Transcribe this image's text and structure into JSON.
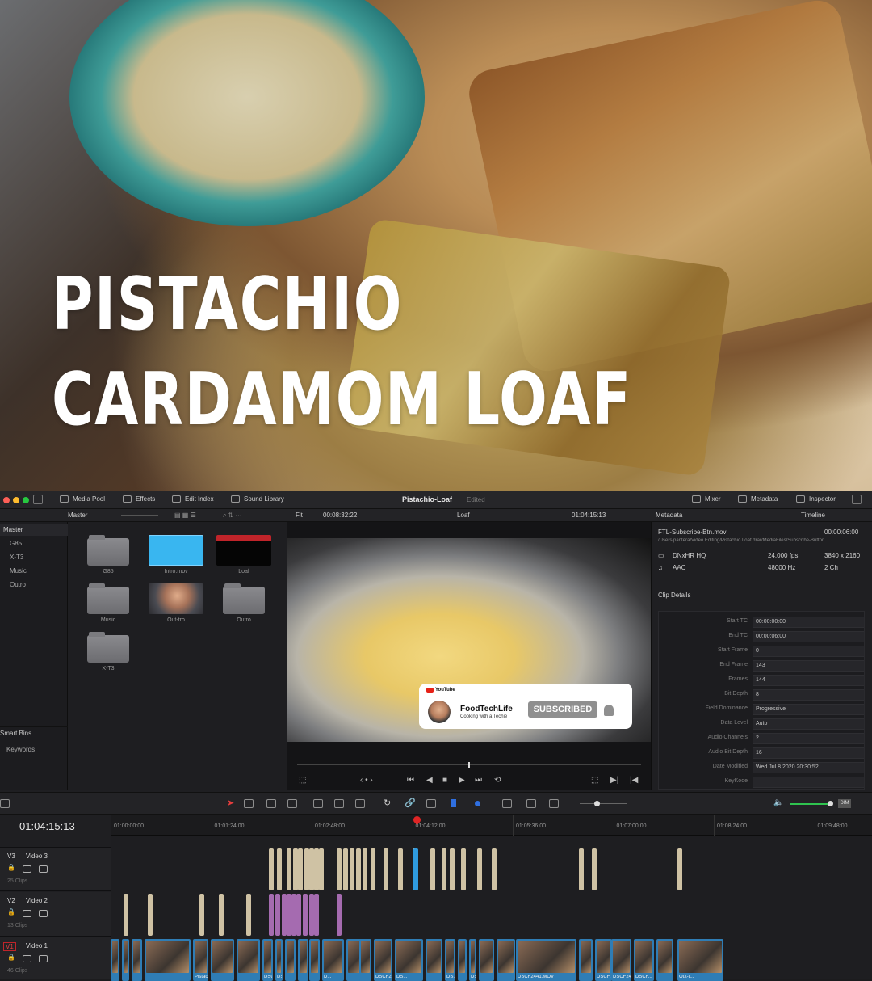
{
  "hero": {
    "title_line1": "PISTACHIO",
    "title_line2": "CARDAMOM LOAF"
  },
  "topbar": {
    "media_pool": "Media Pool",
    "effects": "Effects",
    "edit_index": "Edit Index",
    "sound_library": "Sound Library",
    "project_title": "Pistachio-Loaf",
    "project_status": "Edited",
    "mixer": "Mixer",
    "metadata": "Metadata",
    "inspector": "Inspector"
  },
  "subbar": {
    "bin": "Master",
    "fit": "Fit",
    "source_tc": "00:08:32:22",
    "timeline_name": "Loaf",
    "record_tc": "01:04:15:13",
    "meta_title": "Metadata",
    "meta_scope": "Timeline"
  },
  "bins": {
    "master": "Master",
    "items": [
      "G85",
      "X-T3",
      "Music",
      "Outro"
    ],
    "smart_bins": "Smart Bins",
    "keywords": "Keywords"
  },
  "pool": {
    "clips": [
      "G85",
      "Intro.mov",
      "Loaf",
      "Music",
      "Out-tro",
      "Outro",
      "X-T3"
    ]
  },
  "youtube_card": {
    "brand": "YouTube",
    "channel": "FoodTechLife",
    "tagline": "Cooking with a Techie",
    "button": "SUBSCRIBED"
  },
  "metadata": {
    "filename": "FTL-Subscribe-Btn.mov",
    "duration": "00:00:06:00",
    "path": "/Users/pantera/Video Editing/Pistachio Loaf.drar/MediaFiles/Subscribe-Button",
    "codec": "DNxHR HQ",
    "fps": "24.000 fps",
    "resolution": "3840 x 2160",
    "audio_codec": "AAC",
    "sample_rate": "48000 Hz",
    "channels": "2 Ch",
    "section": "Clip Details",
    "fields": [
      {
        "label": "Start TC",
        "value": "00:00:00:00"
      },
      {
        "label": "End TC",
        "value": "00:00:06:00"
      },
      {
        "label": "Start Frame",
        "value": "0"
      },
      {
        "label": "End Frame",
        "value": "143"
      },
      {
        "label": "Frames",
        "value": "144"
      },
      {
        "label": "Bit Depth",
        "value": "8"
      },
      {
        "label": "Field Dominance",
        "value": "Progressive"
      },
      {
        "label": "Data Level",
        "value": "Auto"
      },
      {
        "label": "Audio Channels",
        "value": "2"
      },
      {
        "label": "Audio Bit Depth",
        "value": "16"
      },
      {
        "label": "Date Modified",
        "value": "Wed Jul 8 2020 20:30:52"
      },
      {
        "label": "KeyKode",
        "value": ""
      }
    ]
  },
  "timeline": {
    "timecode": "01:04:15:13",
    "ruler": [
      "01:00:00:00",
      "01:01:24:00",
      "01:02:48:00",
      "01:04:12:00",
      "01:05:36:00",
      "01:07:00:00",
      "01:08:24:00",
      "01:09:48:00"
    ],
    "tracks": [
      {
        "id": "V3",
        "name": "Video 3",
        "clips": "25 Clips"
      },
      {
        "id": "V2",
        "name": "Video 2",
        "clips": "13 Clips"
      },
      {
        "id": "V1",
        "name": "Video 1",
        "clips": "46 Clips"
      }
    ],
    "v1_labels": [
      "Pistachio-Blen...",
      "DSCF...",
      "DSCF...",
      "D...",
      "DSCF2...",
      "DS...",
      "DS...",
      "DS...",
      "DSCF2441.MOV",
      "DSCF...",
      "DSCF24...",
      "DSCF...",
      "Out-t..."
    ]
  },
  "colors": {
    "accent_blue": "#2f9be0",
    "clip_tan": "#cfc2a4",
    "clip_purple": "#a56bb0",
    "v1_blue": "#2f7db5",
    "playhead": "#e02525"
  }
}
